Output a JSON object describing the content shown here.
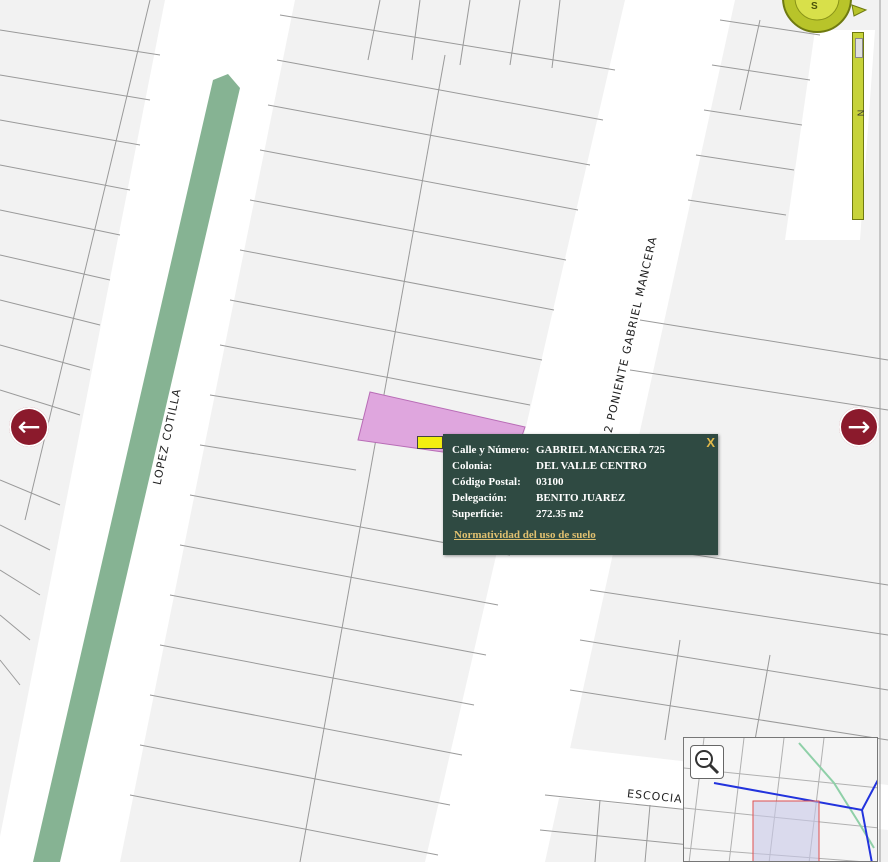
{
  "map": {
    "street_labels": {
      "lopez_cotilla": "LOPEZ COTILLA",
      "gabriel_mancera": "EJE 2 PONIENTE GABRIEL MANCERA",
      "escocia": "ESCOCIA"
    },
    "colors": {
      "background": "#f2f2f2",
      "road": "#ffffff",
      "median": "#86b393",
      "highlight_parcel": "#dfa6de",
      "popup_bg": "#2f4a42",
      "nav_arrow": "#8b1a2c",
      "zoom_control": "#c7d33a"
    }
  },
  "compass": {
    "label": "S",
    "icon": "compass-icon"
  },
  "zoom_slider": {
    "level_label": "N"
  },
  "popup": {
    "close_label": "X",
    "fields": [
      {
        "label": "Calle y Número:",
        "value": "GABRIEL MANCERA 725"
      },
      {
        "label": "Colonia:",
        "value": "DEL VALLE CENTRO"
      },
      {
        "label": "Código Postal:",
        "value": "03100"
      },
      {
        "label": "Delegación:",
        "value": "BENITO JUAREZ"
      },
      {
        "label": "Superficie:",
        "value": "272.35 m2"
      }
    ],
    "link": "Normatividad del uso de suelo"
  },
  "nav": {
    "left_icon": "arrow-left-icon",
    "right_icon": "arrow-right-icon",
    "left_glyph": "←",
    "right_glyph": "→"
  },
  "overview": {
    "zoom_icon": "magnifier-minus-icon"
  }
}
